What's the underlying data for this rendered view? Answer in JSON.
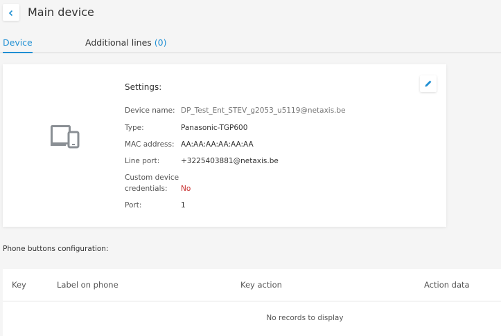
{
  "header": {
    "title": "Main device"
  },
  "tabs": [
    {
      "label": "Device",
      "active": true
    },
    {
      "label": "Additional lines",
      "count": "(0)"
    }
  ],
  "settings": {
    "title": "Settings:",
    "fields": [
      {
        "label": "Device name:",
        "value": "DP_Test_Ent_STEV_g2053_u5119@netaxis.be"
      },
      {
        "label": "Type:",
        "value": "Panasonic-TGP600"
      },
      {
        "label": "MAC address:",
        "value": "AA:AA:AA:AA:AA:AA"
      },
      {
        "label": "Line port:",
        "value": "+3225403881@netaxis.be"
      },
      {
        "label_line1": "Custom device",
        "label_line2": "credentials:",
        "value": "No"
      },
      {
        "label": "Port:",
        "value": "1"
      }
    ]
  },
  "phone_buttons": {
    "label": "Phone buttons configuration:",
    "columns": [
      "Key",
      "Label on phone",
      "Key action",
      "Action data"
    ],
    "empty_message": "No records to display"
  },
  "colors": {
    "accent": "#1f8fd3",
    "danger": "#c62828",
    "icon_gray": "#8a8f94"
  },
  "icons": {
    "back": "chevron-left-icon",
    "edit": "pencil-icon",
    "device": "devices-icon"
  }
}
